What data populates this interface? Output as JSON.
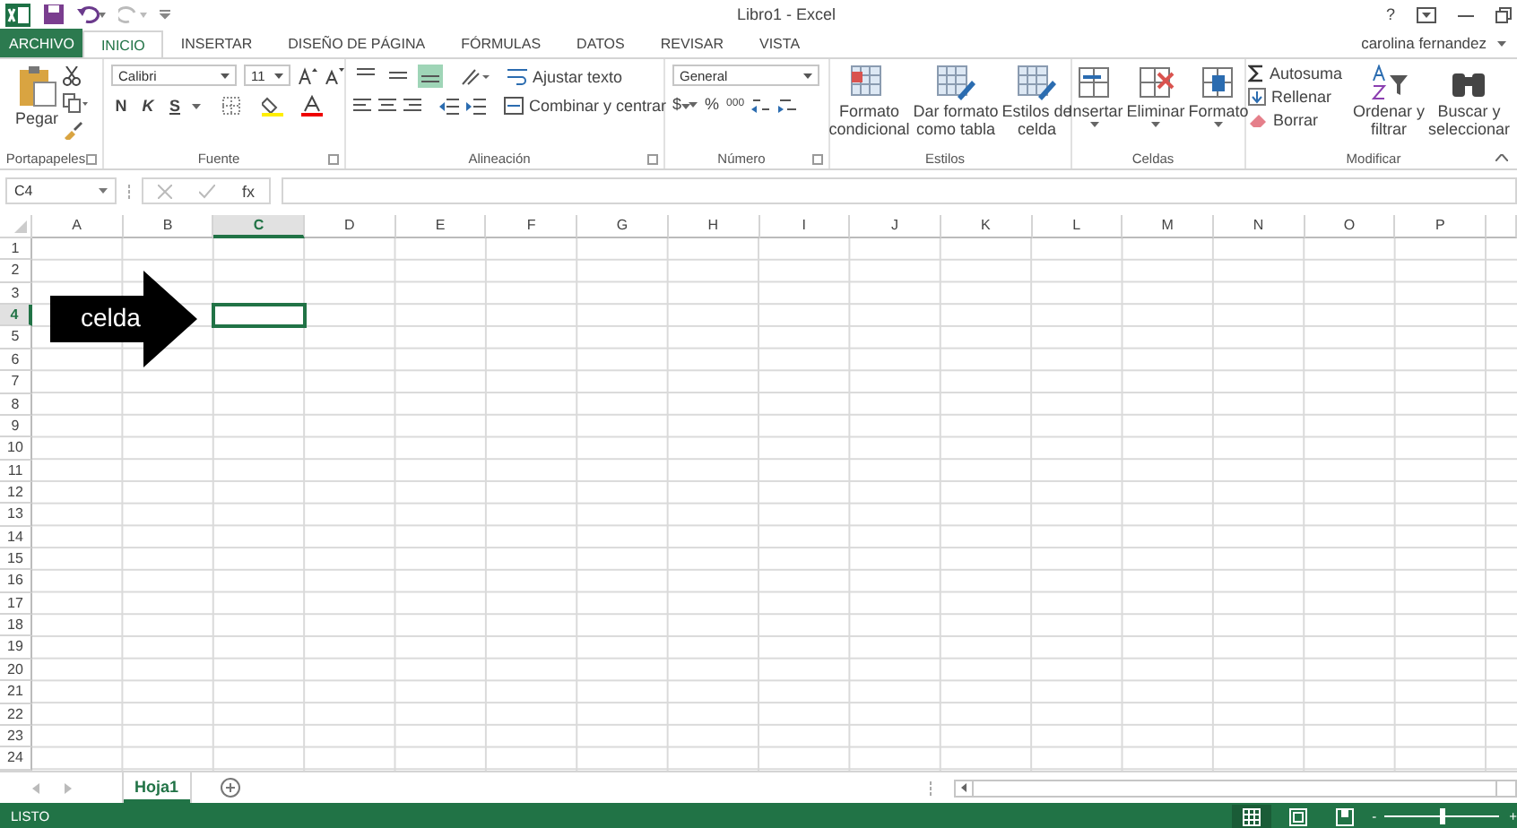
{
  "title_bar": {
    "title": "Libro1 - Excel",
    "help": "?",
    "user": "carolina fernandez"
  },
  "tabs": [
    {
      "label": "ARCHIVO",
      "kind": "file",
      "selected": false
    },
    {
      "label": "INICIO",
      "kind": "tab",
      "selected": true
    },
    {
      "label": "INSERTAR",
      "kind": "tab",
      "selected": false
    },
    {
      "label": "DISEÑO DE PÁGINA",
      "kind": "tab",
      "selected": false
    },
    {
      "label": "FÓRMULAS",
      "kind": "tab",
      "selected": false
    },
    {
      "label": "DATOS",
      "kind": "tab",
      "selected": false
    },
    {
      "label": "REVISAR",
      "kind": "tab",
      "selected": false
    },
    {
      "label": "VISTA",
      "kind": "tab",
      "selected": false
    }
  ],
  "ribbon": {
    "clipboard": {
      "label": "Portapapeles",
      "paste": "Pegar"
    },
    "font": {
      "label": "Fuente",
      "family": "Calibri",
      "size": "11",
      "bold": "N",
      "italic": "K",
      "underline": "S"
    },
    "alignment": {
      "label": "Alineación",
      "vertical_align_buttons": [
        {
          "selected": false
        },
        {
          "selected": false
        },
        {
          "selected": true
        }
      ],
      "wrap": "Ajustar texto",
      "merge": "Combinar y centrar"
    },
    "number": {
      "label": "Número",
      "format": "General",
      "currency": "$",
      "percent": "%",
      "thousands": "000"
    },
    "styles": {
      "label": "Estilos",
      "buttons": [
        "Formato\ncondicional",
        "Dar formato\ncomo tabla",
        "Estilos de\ncelda"
      ]
    },
    "cells": {
      "label": "Celdas",
      "buttons": [
        "Insertar",
        "Eliminar",
        "Formato"
      ]
    },
    "editing": {
      "label": "Modificar",
      "autosum": "Autosuma",
      "fill": "Rellenar",
      "clear": "Borrar",
      "buttons": [
        "Ordenar y\nfiltrar",
        "Buscar y\nseleccionar"
      ]
    }
  },
  "formula_bar": {
    "name_box": "C4",
    "function_label": "fx"
  },
  "columns": [
    {
      "label": "A",
      "selected": false
    },
    {
      "label": "B",
      "selected": false
    },
    {
      "label": "C",
      "selected": true
    },
    {
      "label": "D",
      "selected": false
    },
    {
      "label": "E",
      "selected": false
    },
    {
      "label": "F",
      "selected": false
    },
    {
      "label": "G",
      "selected": false
    },
    {
      "label": "H",
      "selected": false
    },
    {
      "label": "I",
      "selected": false
    },
    {
      "label": "J",
      "selected": false
    },
    {
      "label": "K",
      "selected": false
    },
    {
      "label": "L",
      "selected": false
    },
    {
      "label": "M",
      "selected": false
    },
    {
      "label": "N",
      "selected": false
    },
    {
      "label": "O",
      "selected": false
    },
    {
      "label": "P",
      "selected": false
    }
  ],
  "rows": [
    {
      "label": "1",
      "selected": false
    },
    {
      "label": "2",
      "selected": false
    },
    {
      "label": "3",
      "selected": false
    },
    {
      "label": "4",
      "selected": true
    },
    {
      "label": "5",
      "selected": false
    },
    {
      "label": "6",
      "selected": false
    },
    {
      "label": "7",
      "selected": false
    },
    {
      "label": "8",
      "selected": false
    },
    {
      "label": "9",
      "selected": false
    },
    {
      "label": "10",
      "selected": false
    },
    {
      "label": "11",
      "selected": false
    },
    {
      "label": "12",
      "selected": false
    },
    {
      "label": "13",
      "selected": false
    },
    {
      "label": "14",
      "selected": false
    },
    {
      "label": "15",
      "selected": false
    },
    {
      "label": "16",
      "selected": false
    },
    {
      "label": "17",
      "selected": false
    },
    {
      "label": "18",
      "selected": false
    },
    {
      "label": "19",
      "selected": false
    },
    {
      "label": "20",
      "selected": false
    },
    {
      "label": "21",
      "selected": false
    },
    {
      "label": "22",
      "selected": false
    },
    {
      "label": "23",
      "selected": false
    },
    {
      "label": "24",
      "selected": false
    }
  ],
  "callout": {
    "text": "celda"
  },
  "sheets": [
    {
      "label": "Hoja1",
      "selected": true
    }
  ],
  "status_bar": {
    "text": "LISTO",
    "zoom": {
      "minus": "-",
      "plus": "+",
      "level": 0.5
    }
  }
}
